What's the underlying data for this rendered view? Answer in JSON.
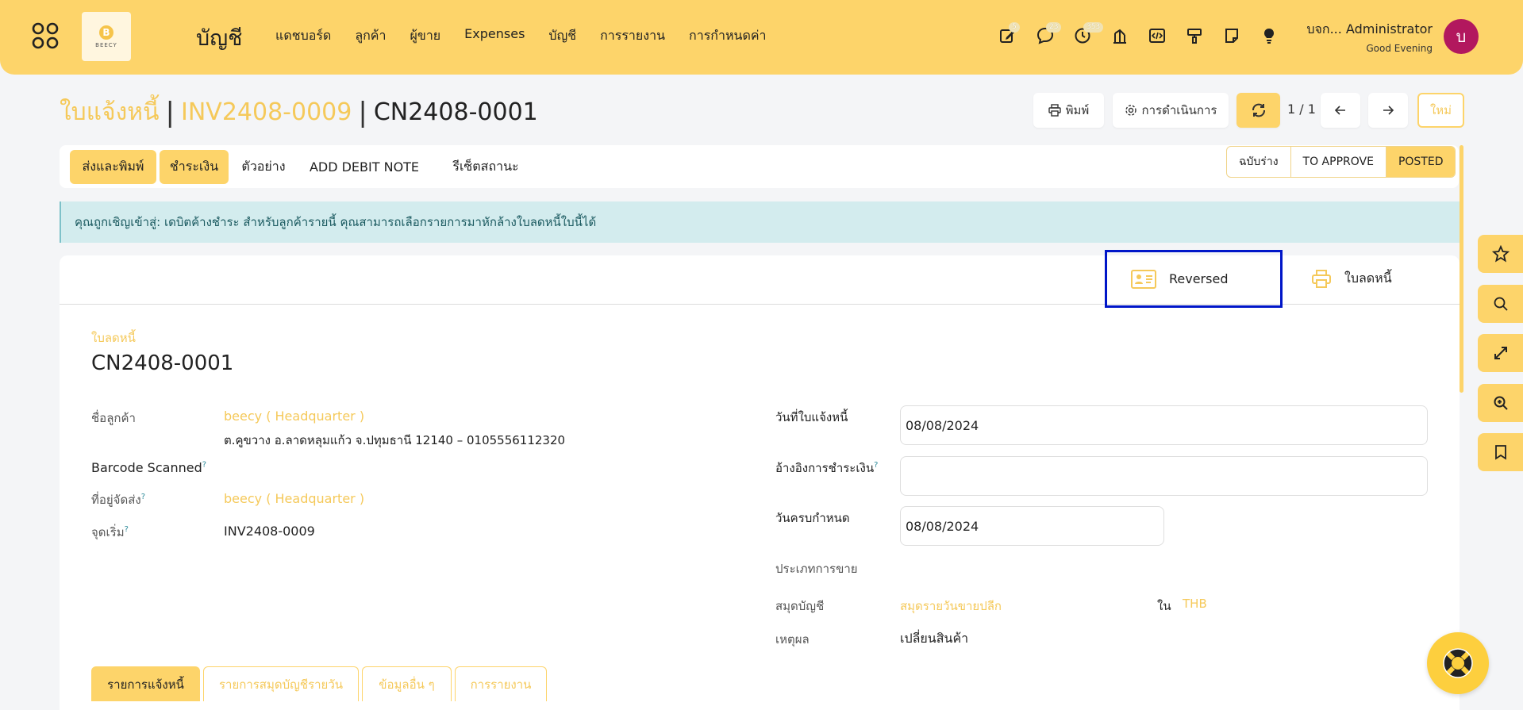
{
  "header": {
    "app_title": "บัญชี",
    "logo_text": "BEECY",
    "logo_letter": "B",
    "nav": [
      "แดชบอร์ด",
      "ลูกค้า",
      "ผู้ขาย",
      "Expenses",
      "บัญชี",
      "การรายงาน",
      "การกำหนดค่า"
    ],
    "icons": [
      {
        "name": "edit-icon",
        "badge": "5"
      },
      {
        "name": "chat-icon",
        "badge": "23"
      },
      {
        "name": "clock-icon",
        "badge": "353"
      },
      {
        "name": "bank-icon",
        "badge": ""
      },
      {
        "name": "code-icon",
        "badge": ""
      },
      {
        "name": "paint-icon",
        "badge": ""
      },
      {
        "name": "note-icon",
        "badge": ""
      },
      {
        "name": "bulb-icon",
        "badge": ""
      }
    ],
    "user_name": "บจก... Administrator",
    "greeting": "Good Evening",
    "avatar_letter": "บ"
  },
  "breadcrumb": {
    "root": "ใบแจ้งหนี้",
    "parent": "INV2408-0009",
    "current": "CN2408-0001"
  },
  "toolbar": {
    "print": "พิมพ์",
    "actions": "การดำเนินการ",
    "pager": "1 / 1",
    "new": "ใหม่"
  },
  "actionbar": {
    "buttons": [
      "ส่งและพิมพ์",
      "ชำระเงิน",
      "ตัวอย่าง",
      "ADD DEBIT NOTE",
      "รีเซ็ตสถานะ"
    ],
    "statuses": [
      "ฉบับร่าง",
      "TO APPROVE",
      "POSTED"
    ]
  },
  "alert": "คุณถูกเชิญเข้าสู่: เดบิตค้างชำระ สำหรับลูกค้ารายนี้ คุณสามารถเลือกรายการมาหักล้างใบลดหนี้ใบนี้ได้",
  "smart_buttons": {
    "reversed": "Reversed",
    "credit_note": "ใบลดหนี้"
  },
  "form": {
    "type_label": "ใบลดหนี้",
    "name": "CN2408-0001",
    "customer_label": "ชื่อลูกค้า",
    "customer": "beecy ( Headquarter )",
    "customer_address": "ต.คูขวาง อ.ลาดหลุมแก้ว จ.ปทุมธานี 12140 – 0105556112320",
    "barcode_label": "Barcode Scanned",
    "shipping_label": "ที่อยู่จัดส่ง",
    "shipping": "beecy ( Headquarter )",
    "origin_label": "จุดเริ่ม",
    "origin": "INV2408-0009",
    "invoice_date_label": "วันที่ใบแจ้งหนี้",
    "invoice_date": "08/08/2024",
    "payment_ref_label": "อ้างอิงการชำระเงิน",
    "payment_ref": "",
    "due_date_label": "วันครบกำหนด",
    "due_date": "08/08/2024",
    "sale_type_label": "ประเภทการขาย",
    "journal_label": "สมุดบัญชี",
    "journal": "สมุดรายวันขายปลีก",
    "in_label": "ใน",
    "currency": "THB",
    "reason_label": "เหตุผล",
    "reason": "เปลี่ยนสินค้า",
    "tooltip_mark": "?"
  },
  "tabs": [
    "รายการแจ้งหนี้",
    "รายการสมุดบัญชีรายวัน",
    "ข้อมูลอื่น ๆ",
    "การรายงาน"
  ],
  "dock_icons": [
    "star-icon",
    "search-icon",
    "expand-icon",
    "zoom-icon",
    "bookmark-icon"
  ],
  "colors": {
    "accent": "#fdd46a",
    "link": "#f5c95a",
    "alert_bg": "#d3ecee",
    "avatar": "#b2185e",
    "selection_border": "#0016c8"
  }
}
